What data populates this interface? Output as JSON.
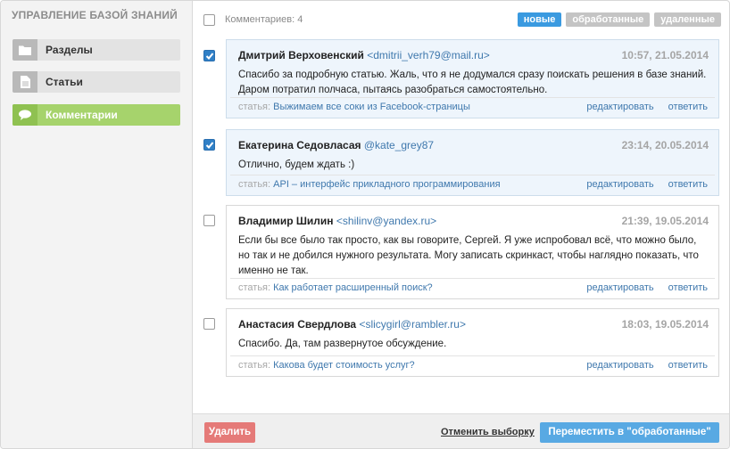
{
  "sidebar": {
    "title": "УПРАВЛЕНИЕ БАЗОЙ ЗНАНИЙ",
    "items": [
      {
        "label": "Разделы",
        "icon": "folder-icon"
      },
      {
        "label": "Статьи",
        "icon": "document-icon"
      },
      {
        "label": "Комментарии",
        "icon": "comment-icon",
        "active": true
      }
    ]
  },
  "toolbar": {
    "count_label": "Комментариев: 4",
    "filters": [
      "новые",
      "обработанные",
      "удаленные"
    ],
    "active_filter": "новые"
  },
  "comments": [
    {
      "author": "Дмитрий Верховенский",
      "email": "<dmitrii_verh79@mail.ru>",
      "date": "10:57, 21.05.2014",
      "text": "Спасибо за подробную статью. Жаль, что я не додумался сразу поискать решения в базе знаний. Даром потратил полчаса, пытаясь разобраться самостоятельно.",
      "article_label": "статья:",
      "article": "Выжимаем все соки из Facebook-страницы",
      "checked": true
    },
    {
      "author": "Екатерина Седовласая",
      "email": "@kate_grey87",
      "date": "23:14, 20.05.2014",
      "text": "Отлично, будем ждать :)",
      "article_label": "статья:",
      "article": "API – интерфейс прикладного программирования",
      "checked": true
    },
    {
      "author": "Владимир Шилин",
      "email": "<shilinv@yandex.ru>",
      "date": "21:39, 19.05.2014",
      "text": "Если бы все было так просто, как вы говорите, Сергей. Я уже испробовал всё, что можно было, но так и не добился нужного результата. Могу записать скринкаст, чтобы наглядно показать, что именно не так.",
      "article_label": "статья:",
      "article": "Как работает расширенный поиск?",
      "checked": false
    },
    {
      "author": "Анастасия Свердлова",
      "email": "<slicygirl@rambler.ru>",
      "date": "18:03, 19.05.2014",
      "text": "Спасибо. Да, там развернутое обсуждение.",
      "article_label": "статья:",
      "article": "Какова будет стоимость услуг?",
      "checked": false
    }
  ],
  "comment_actions": {
    "edit": "редактировать",
    "reply": "ответить"
  },
  "bottom": {
    "delete_label": "Удалить",
    "reset_label": "Отменить выборку",
    "move_label": "Переместить в \"обработанные\""
  },
  "colors": {
    "accent": "#3a9ae0",
    "active_nav": "#a6d36c",
    "danger": "#e57a78",
    "link": "#3f78ad"
  }
}
